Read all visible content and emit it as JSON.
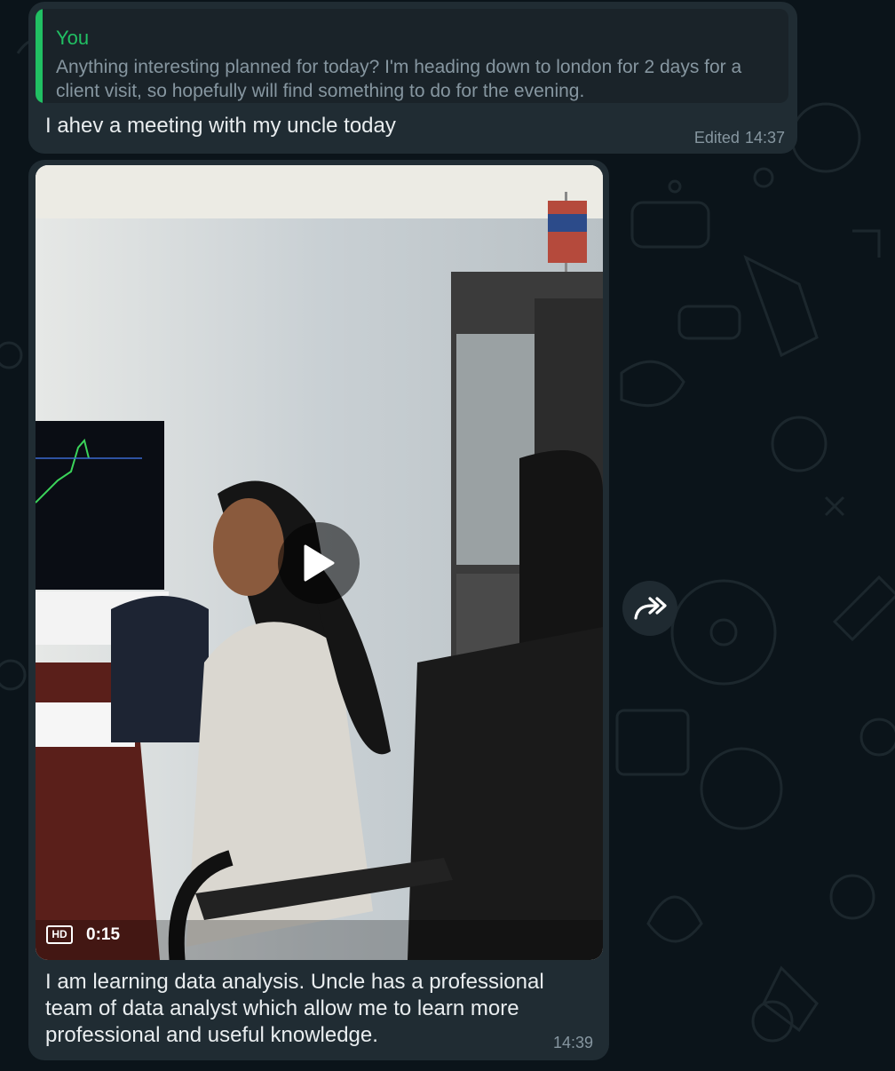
{
  "message1": {
    "quote_author": "You",
    "quote_text": "Anything interesting planned for today? I'm heading down to london for 2 days for a client visit, so hopefully will find something to do for the evening.",
    "text": "I ahev a meeting with my uncle today",
    "edited_label": "Edited",
    "time": "14:37"
  },
  "message2": {
    "video": {
      "hd_label": "HD",
      "duration": "0:15",
      "play_icon": "play-icon"
    },
    "caption": "I am learning data analysis. Uncle has a professional team of data analyst which allow me to learn more professional and useful knowledge.",
    "time": "14:39"
  },
  "forward": {
    "icon": "forward-icon"
  },
  "colors": {
    "background": "#0b141a",
    "bubble": "#202c33",
    "quote_accent": "#21c063",
    "meta_text": "#8696a0"
  }
}
